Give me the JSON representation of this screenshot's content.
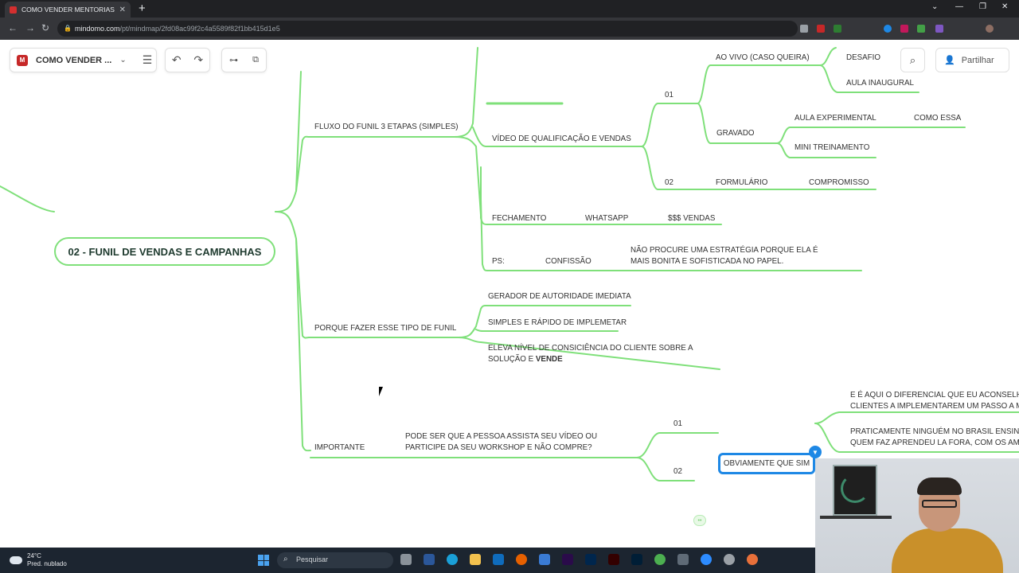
{
  "browser": {
    "tab_title": "COMO VENDER MENTORIAS E PR",
    "tab_close": "✕",
    "new_tab": "+",
    "url_host": "mindomo.com",
    "url_path": "/pt/mindmap/2fd08ac99f2c4a5589f82f1bb415d1e5"
  },
  "toolbar": {
    "map_title": "COMO VENDER ...",
    "share_label": "Partilhar"
  },
  "mindmap": {
    "central": "02 - FUNIL DE VENDAS E CAMPANHAS",
    "fluxo": "FLUXO DO FUNIL 3 ETAPAS (SIMPLES)",
    "video_qual": "VÍDEO DE QUALIFICAÇÃO E VENDAS",
    "n01_top": "01",
    "ao_vivo": "AO VIVO (CASO QUEIRA)",
    "desafio": "DESAFIO",
    "aula_inaugural": "AULA INAUGURAL",
    "gravado": "GRAVADO",
    "aula_experimental": "AULA EXPERIMENTAL",
    "como_essa": "COMO ESSA",
    "mini_treinamento": "MINI TREINAMENTO",
    "n02_top": "02",
    "formulario": "FORMULÁRIO",
    "compromisso": "COMPROMISSO",
    "fechamento": "FECHAMENTO",
    "whatsapp": "WHATSAPP",
    "vendas": "$$$ VENDAS",
    "ps": "PS:",
    "confissao": "CONFISSÃO",
    "nao_procure": "NÃO PROCURE UMA ESTRATÉGIA PORQUE ELA É MAIS BONITA E SOFISTICADA NO PAPEL.",
    "porque": "PORQUE FAZER ESSE TIPO DE FUNIL",
    "gerador": "GERADOR DE AUTORIDADE IMEDIATA",
    "simples": "SIMPLES E RÁPIDO DE IMPLEMETAR",
    "eleva": "ELEVA NÍVEL DE CONSICIÊNCIA DO CLIENTE SOBRE A SOLUÇÃO E ",
    "eleva_bold": "VENDE",
    "importante": "IMPORTANTE",
    "pode_ser": "PODE SER QUE A PESSOA ASSISTA SEU VÍDEO OU PARTICIPE DA SEU WORKSHOP E NÃO COMPRE?",
    "n01_bottom": "01",
    "obviamente": "OBVIAMENTE QUE SIM",
    "diferencial": "E É AQUI O DIFERENCIAL QUE EU ACONSELHO E CLIENTES A IMPLEMENTAREM UM PASSO A M",
    "praticamente": "PRATICAMENTE NINGUÉM NO BRASIL ENSINA QUEM FAZ APRENDEU LA FORA, COM OS AMER",
    "n02_bottom": "02"
  },
  "taskbar": {
    "temp": "24°C",
    "weather": "Pred. nublado",
    "search_label": "Pesquisar"
  },
  "colors": {
    "branch": "#7fe07a",
    "accent": "#1e88e5"
  }
}
